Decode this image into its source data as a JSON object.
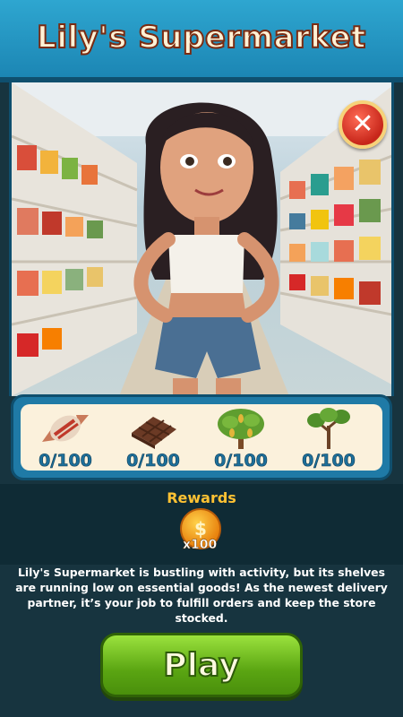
{
  "header": {
    "title": "Lily's Supermarket"
  },
  "scene": {
    "character": "Lily",
    "close_icon": "close-icon"
  },
  "items": [
    {
      "icon": "candy-icon",
      "count": "0/100"
    },
    {
      "icon": "chocolate-icon",
      "count": "0/100"
    },
    {
      "icon": "cacao-tree-icon",
      "count": "0/100"
    },
    {
      "icon": "sapling-tree-icon",
      "count": "0/100"
    }
  ],
  "rewards": {
    "label": "Rewards",
    "coin_symbol": "$",
    "multiplier": "x100"
  },
  "description": "Lily's Supermarket is bustling with activity, but its shelves are running low on essential goods! As the newest delivery partner, it’s your job to fulfill orders and keep the store stocked.",
  "play_button": {
    "label": "Play"
  },
  "colors": {
    "header": "#2ea6d0",
    "play": "#6cc01b",
    "close": "#d8321f",
    "coin": "#f3a21a",
    "rewards_label": "#ffc233"
  }
}
